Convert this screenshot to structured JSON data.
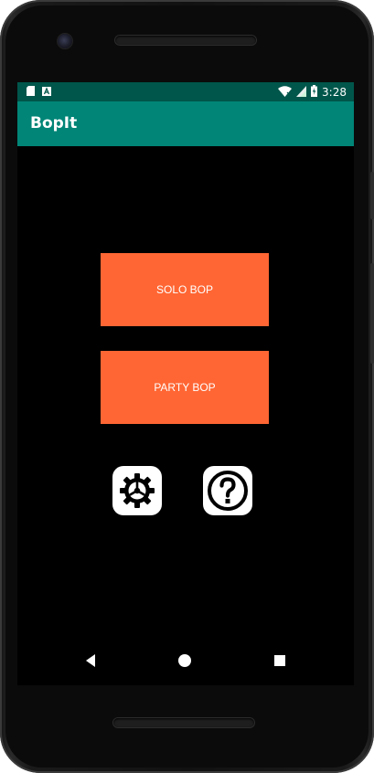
{
  "status_bar": {
    "time": "3:28",
    "icons": [
      "sd-card-icon",
      "a-notification-icon",
      "wifi-icon",
      "signal-icon",
      "battery-charging-icon"
    ],
    "background": "#00564b"
  },
  "app_bar": {
    "title": "BopIt",
    "background": "#008577"
  },
  "main": {
    "solo_label": "SOLO BOP",
    "party_label": "PARTY BOP",
    "button_color": "#ff6633",
    "settings_icon": "gear-icon",
    "help_icon": "question-mark-icon"
  },
  "nav_bar": {
    "buttons": [
      "back-icon",
      "home-icon",
      "recents-icon"
    ]
  }
}
